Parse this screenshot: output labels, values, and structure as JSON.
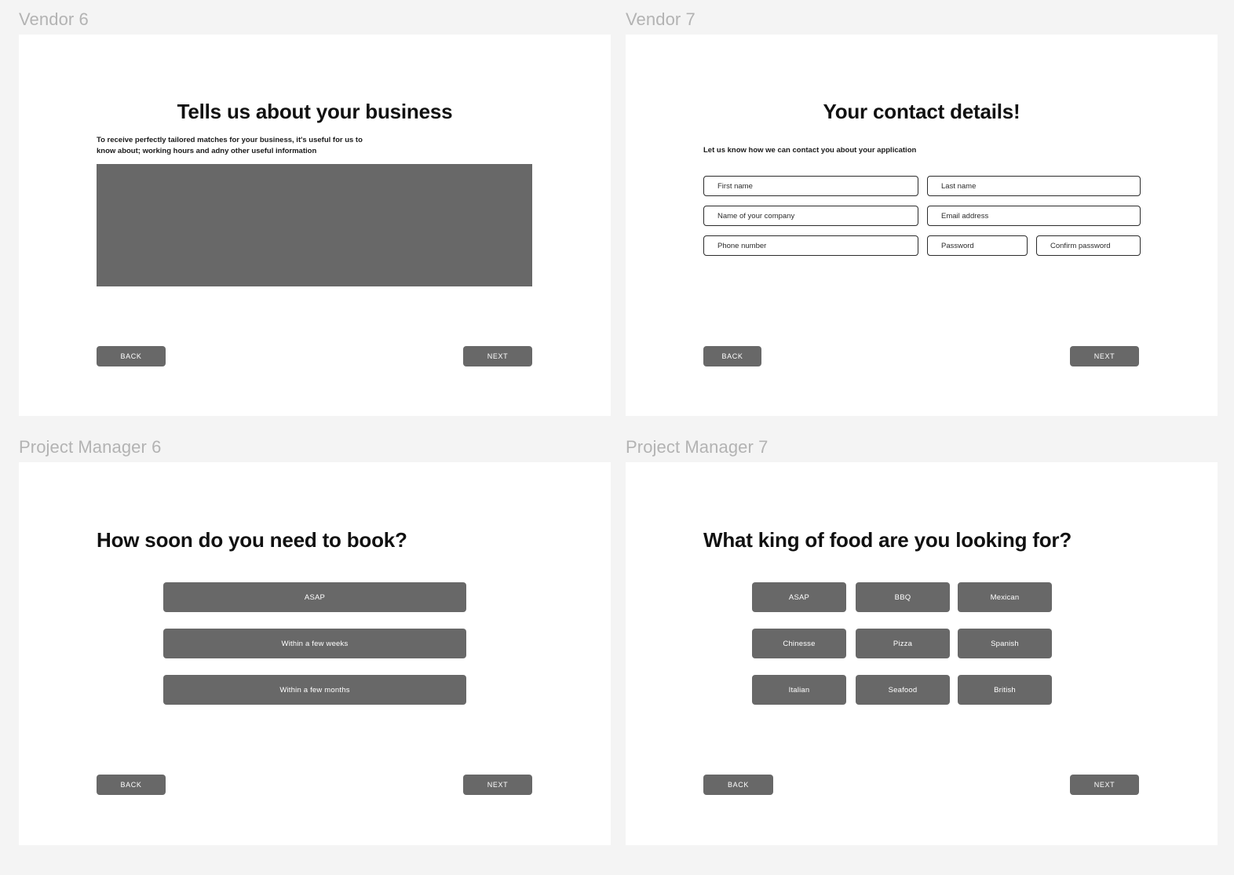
{
  "theme": {
    "page_background": "#f4f4f4",
    "card_background": "#ffffff",
    "accent_gray": "#686868",
    "frame_label_color": "#b3b3b3",
    "text_color": "#111111",
    "input_border_color": "#2b2b2b"
  },
  "frames": [
    {
      "label": "Vendor 6",
      "screen": {
        "title": "Tells us about your business",
        "body": "To receive perfectly tailored matches for your business, it's useful for us to\nknow about; working hours and adny other useful information",
        "textarea_placeholder": "",
        "back_label": "BACK",
        "next_label": "NEXT"
      }
    },
    {
      "label": "Vendor 7",
      "screen": {
        "title": "Your contact details!",
        "subtitle": "Let us know how we can contact you about your application",
        "fields": [
          {
            "name": "first-name",
            "placeholder": "First name",
            "value": ""
          },
          {
            "name": "last-name",
            "placeholder": "Last name",
            "value": ""
          },
          {
            "name": "company-name",
            "placeholder": "Name of your company",
            "value": ""
          },
          {
            "name": "email-address",
            "placeholder": "Email address",
            "value": ""
          },
          {
            "name": "phone-number",
            "placeholder": "Phone number",
            "value": ""
          },
          {
            "name": "password",
            "placeholder": "Password",
            "value": ""
          },
          {
            "name": "confirm-password",
            "placeholder": "Confirm password",
            "value": ""
          }
        ],
        "back_label": "BACK",
        "next_label": "NEXT"
      }
    },
    {
      "label": "Project Manager 6",
      "screen": {
        "title": "How soon do you need to book?",
        "options": [
          "ASAP",
          "Within a few weeks",
          "Within a few months"
        ],
        "back_label": "BACK",
        "next_label": "NEXT"
      }
    },
    {
      "label": "Project Manager 7",
      "screen": {
        "title": "What king of food are you looking for?",
        "options": [
          "ASAP",
          "BBQ",
          "Mexican",
          "Chinesse",
          "Pizza",
          "Spanish",
          "Italian",
          "Seafood",
          "British"
        ],
        "back_label": "BACK",
        "next_label": "NEXT"
      }
    }
  ]
}
